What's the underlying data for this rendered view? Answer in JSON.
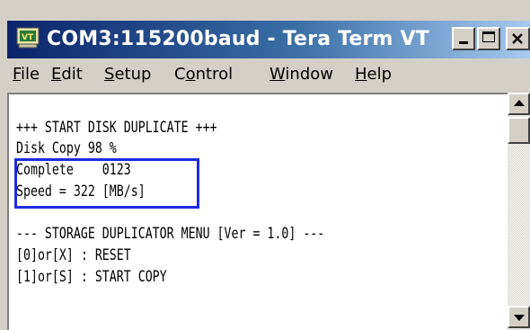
{
  "window": {
    "title": "COM3:115200baud - Tera Term VT",
    "controls": {
      "minimize": "_",
      "maximize": "□",
      "close": "×"
    }
  },
  "menu": {
    "file": "File",
    "edit": "Edit",
    "setup": "Setup",
    "control": "Control",
    "window": "Window",
    "help": "Help"
  },
  "terminal": {
    "lines": [
      "+++ START DISK DUPLICATE +++",
      "Disk Copy 98 %",
      "Complete    0123",
      "Speed = 322 [MB/s]",
      "",
      "--- STORAGE DUPLICATOR MENU [Ver = 1.0] ---",
      "[0]or[X] : RESET",
      "[1]or[S] : START COPY"
    ]
  },
  "colors": {
    "titlebar_start": "#0a246a",
    "titlebar_end": "#a6caf0",
    "highlight_box": "#1c2bdf",
    "chrome": "#d4d0c8"
  },
  "icons": {
    "app": "tera-term-icon",
    "scroll_up": "arrow-up-icon",
    "scroll_down": "arrow-down-icon"
  }
}
